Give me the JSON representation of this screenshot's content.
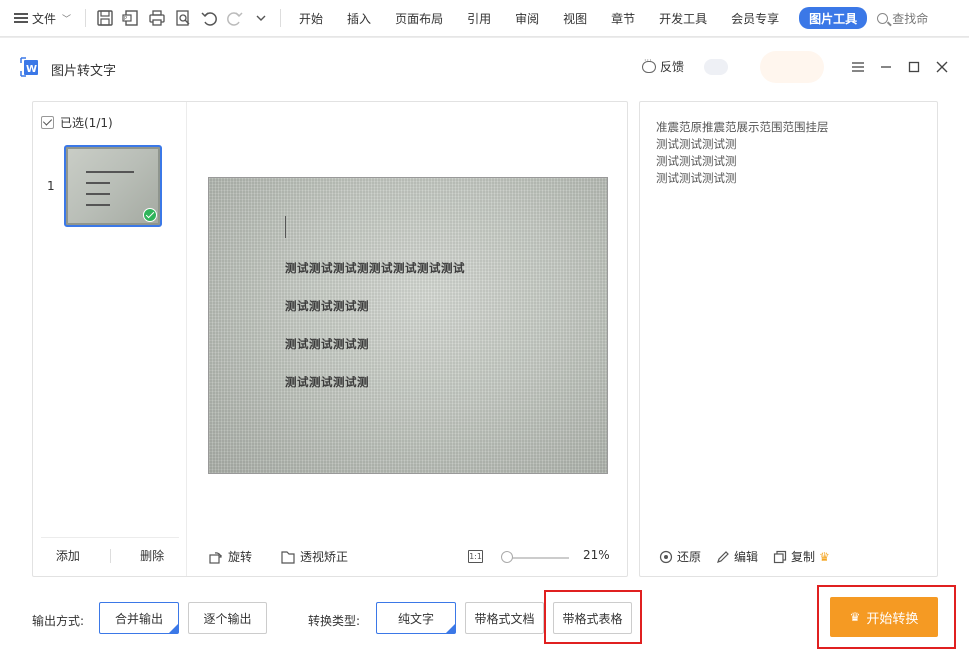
{
  "ribbon": {
    "file_menu": "文件",
    "tabs": [
      "开始",
      "插入",
      "页面布局",
      "引用",
      "审阅",
      "视图",
      "章节",
      "开发工具",
      "会员专享"
    ],
    "active_tab": "图片工具",
    "search_label": "查找命"
  },
  "dialog": {
    "title": "图片转文字",
    "feedback": "反馈"
  },
  "thumbnails": {
    "selected_label": "已选(1/1)",
    "items": [
      {
        "index": "1"
      }
    ],
    "add_label": "添加",
    "delete_label": "删除"
  },
  "preview": {
    "photo_lines": [
      "测试测试测试测测试测试测试测试",
      "测试测试测试测",
      "测试测试测试测",
      "测试测试测试测"
    ],
    "rotate_label": "旋转",
    "perspective_label": "透视矫正",
    "zoom": "21%"
  },
  "result": {
    "lines": [
      "准震范原推震范展示范围范围挂层",
      "测试测试测试测",
      "测试测试测试测",
      "测试测试测试测"
    ],
    "restore_label": "还原",
    "edit_label": "编辑",
    "copy_label": "复制"
  },
  "options": {
    "output_label": "输出方式:",
    "output_modes": [
      "合并输出",
      "逐个输出"
    ],
    "output_selected": "合并输出",
    "convert_label": "转换类型:",
    "convert_types": [
      "纯文字",
      "带格式文档",
      "带格式表格"
    ],
    "convert_selected": "纯文字",
    "start_label": "开始转换"
  },
  "colors": {
    "accent": "#3b78e7",
    "start_button": "#f59a23",
    "highlight": "#e02020",
    "check_green": "#2fb45a"
  }
}
